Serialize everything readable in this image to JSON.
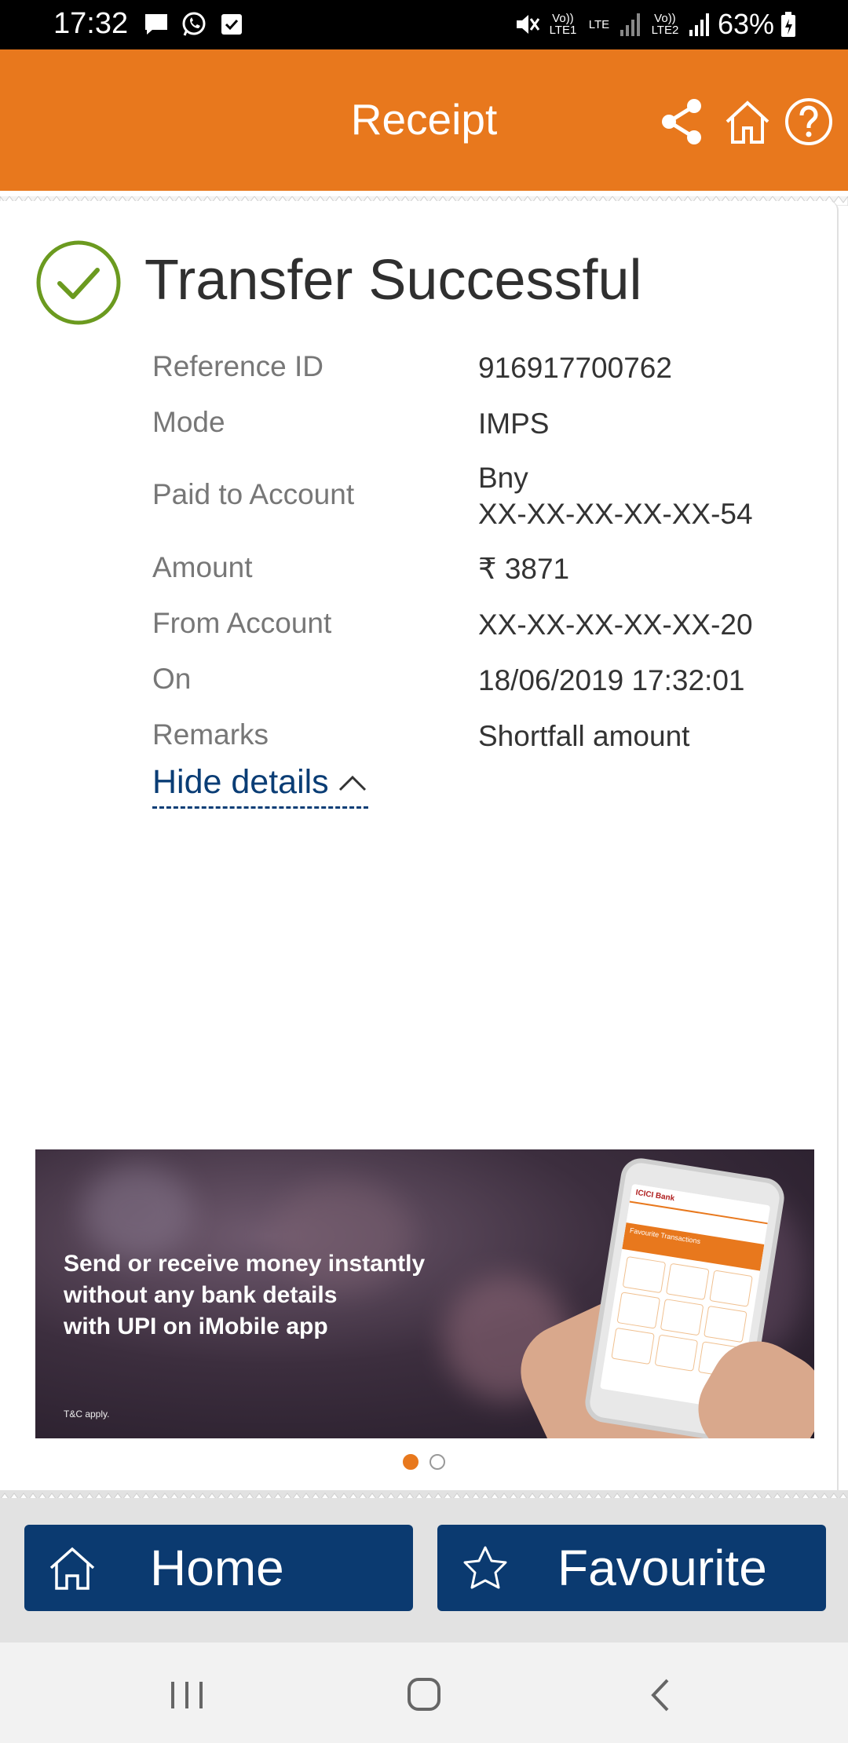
{
  "status_bar": {
    "time": "17:32",
    "sim1_label": "Vo)) LTE1",
    "sim2_label": "Vo)) LTE2",
    "lte_label": "LTE",
    "battery": "63%"
  },
  "header": {
    "title": "Receipt",
    "share_icon": "share-icon",
    "home_icon": "home-icon",
    "help_icon": "help-icon",
    "color": "#e8781d"
  },
  "receipt": {
    "status": "Transfer Successful",
    "status_color": "#6b9a1f",
    "details": [
      {
        "label": "Reference ID",
        "value": "916917700762"
      },
      {
        "label": "Mode",
        "value": "IMPS"
      },
      {
        "label": "Paid to Account",
        "value": "Bny",
        "value2": "XX-XX-XX-XX-XX-54"
      },
      {
        "label": "Amount",
        "value": "₹ 3871"
      },
      {
        "label": "From Account",
        "value": "XX-XX-XX-XX-XX-20"
      },
      {
        "label": "On",
        "value": "18/06/2019 17:32:01"
      },
      {
        "label": "Remarks",
        "value": "Shortfall amount"
      }
    ],
    "toggle_label": "Hide details"
  },
  "banner": {
    "line1": "Send or receive money instantly",
    "line2": "without any bank details",
    "line3": "with UPI on iMobile app",
    "tc": "T&C apply.",
    "phone_brand": "ICICI Bank",
    "phone_strip": "Favourite Transactions",
    "slide_count": 2,
    "active_slide": 1
  },
  "actions": {
    "home_label": "Home",
    "favourite_label": "Favourite",
    "color": "#0b3a70"
  }
}
